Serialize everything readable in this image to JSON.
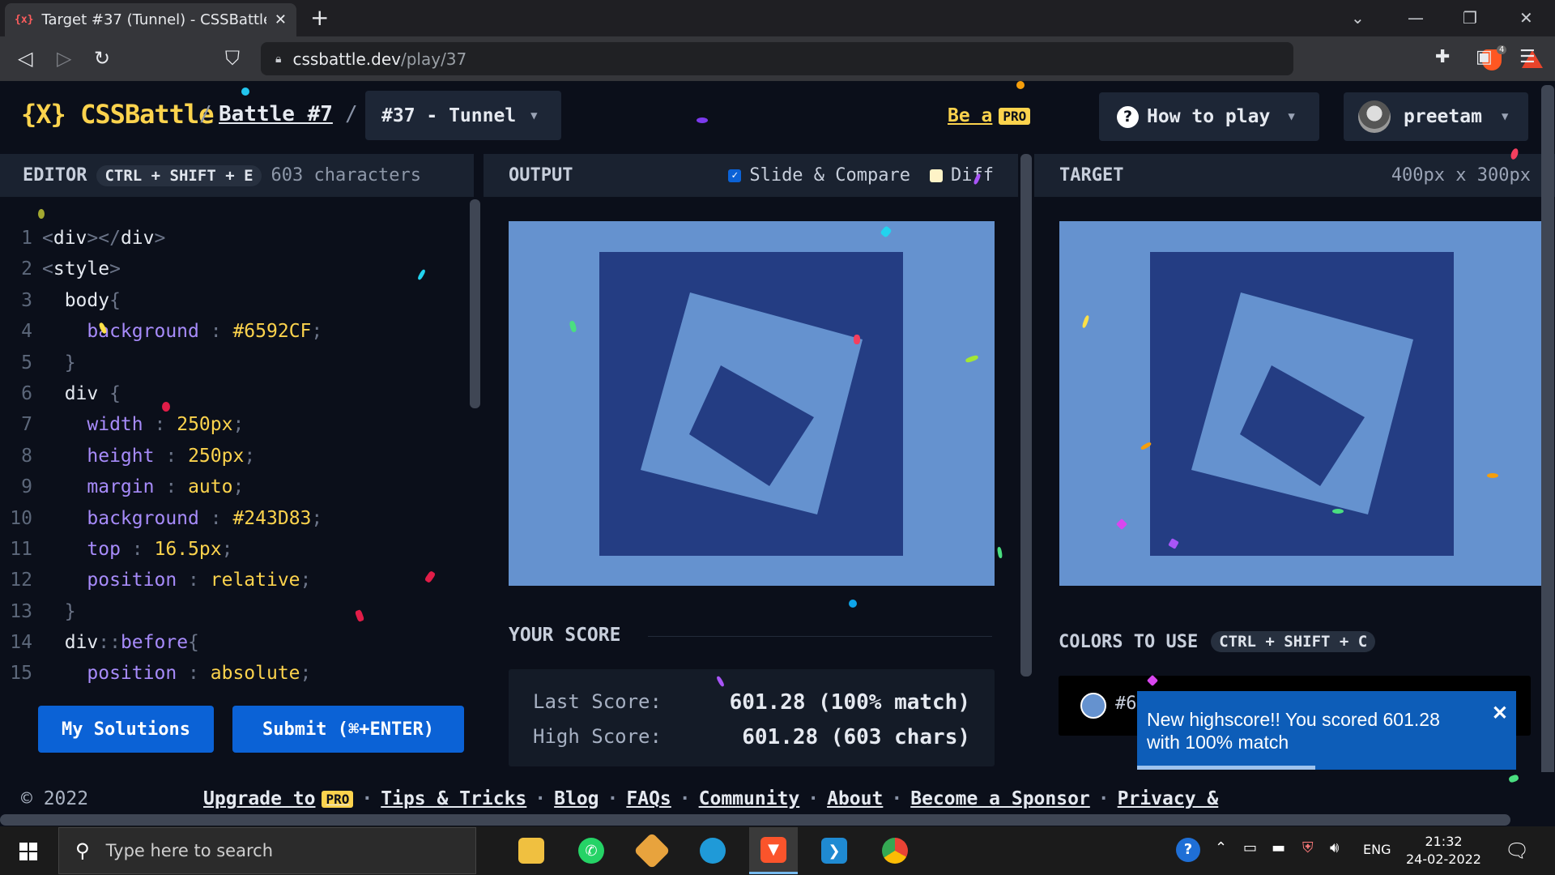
{
  "browser": {
    "tab_favicon": "{x}",
    "tab_title": "Target #37 (Tunnel) - CSSBattle",
    "url_host": "cssbattle.dev",
    "url_path": "/play/37",
    "shield_count": "4"
  },
  "header": {
    "logo": "{X} CSSBattle",
    "separator": "/",
    "battle": "Battle #7",
    "target_select": "#37 - Tunnel",
    "be_a_pro": "Be a",
    "pro_badge": "PRO",
    "how_to_play": "How to play",
    "username": "preetam"
  },
  "editor": {
    "title": "EDITOR",
    "shortcut": "CTRL + SHIFT + E",
    "char_count": "603 characters",
    "my_solutions": "My Solutions",
    "submit": "Submit (⌘+ENTER)"
  },
  "output": {
    "title": "OUTPUT",
    "slide_compare": "Slide & Compare",
    "slide_compare_checked": true,
    "diff": "Diff",
    "diff_checked": false
  },
  "target": {
    "title": "TARGET",
    "dimensions": "400px x 300px"
  },
  "score": {
    "title": "YOUR SCORE",
    "last_label": "Last Score:",
    "last_value": "601.28 (100% match)",
    "high_label": "High Score:",
    "high_value": "601.28 (603 chars)"
  },
  "colors": {
    "title": "COLORS TO USE",
    "shortcut": "CTRL + SHIFT + C",
    "swatch": "#6592CF",
    "swatch_label": "#6"
  },
  "toast": {
    "message": "New highscore!! You scored 601.28 with 100% match",
    "close": "✕",
    "progress": 0.47
  },
  "footer": {
    "copyright": "© 2022",
    "upgrade": "Upgrade to",
    "pro": "PRO",
    "links": [
      "Tips & Tricks",
      "Blog",
      "FAQs",
      "Community",
      "About",
      "Become a Sponsor",
      "Privacy &"
    ],
    "separator": "·"
  },
  "taskbar": {
    "search_placeholder": "Type here to search",
    "language": "ENG",
    "time": "21:32",
    "date": "24-02-2022"
  },
  "theme": {
    "target_bg": "#6592CF",
    "target_fg": "#243D83",
    "accent": "#fcd34d",
    "button": "#0b62d6"
  }
}
